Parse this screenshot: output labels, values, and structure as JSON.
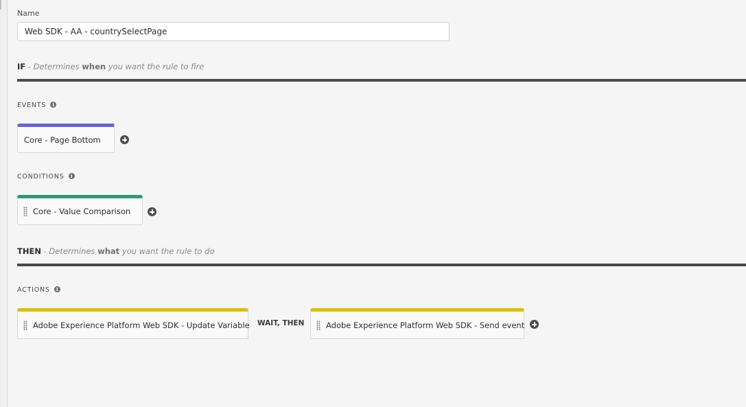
{
  "name_field": {
    "label": "Name",
    "value": "Web SDK - AA - countrySelectPage"
  },
  "if_section": {
    "keyword": "IF",
    "text_before": " - Determines ",
    "emphasis": "when",
    "text_after": " you want the rule to fire"
  },
  "events": {
    "label": "EVENTS",
    "items": [
      {
        "label": "Core - Page Bottom"
      }
    ]
  },
  "conditions": {
    "label": "CONDITIONS",
    "items": [
      {
        "label": "Core - Value Comparison"
      }
    ]
  },
  "then_section": {
    "keyword": "THEN",
    "text_before": " - Determines ",
    "emphasis": "what",
    "text_after": " you want the rule to do"
  },
  "actions": {
    "label": "ACTIONS",
    "items": [
      {
        "label": "Adobe Experience Platform Web SDK - Update Variable"
      },
      {
        "label": "Adobe Experience Platform Web SDK - Send event"
      }
    ],
    "separator": "WAIT, THEN"
  },
  "icons": {
    "info": "info-icon",
    "add": "plus-circle-icon",
    "drag": "drag-handle-icon"
  },
  "colors": {
    "event_accent": "#6a62d9",
    "condition_accent": "#2e9a73",
    "action_accent": "#dcbf00",
    "divider": "#4b4b4b"
  }
}
